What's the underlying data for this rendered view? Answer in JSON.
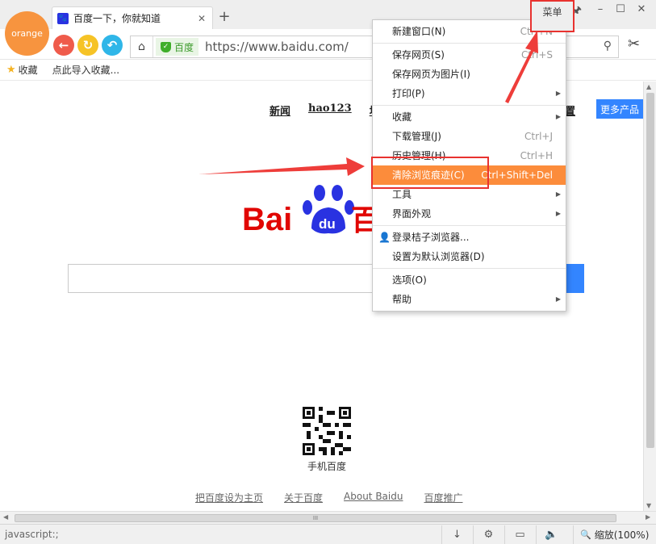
{
  "logo_label": "orange",
  "tab": {
    "title": "百度一下，你就知道",
    "close": "✕",
    "favicon": "paw-icon"
  },
  "new_tab": "+",
  "menu_button": "菜单",
  "window_controls": {
    "pin": "🖈",
    "minimize": "–",
    "maximize": "☐",
    "close": "✕"
  },
  "nav": {
    "back": "←",
    "refresh": "↻",
    "undo": "↶",
    "home": "⌂",
    "cut": "✂"
  },
  "address": {
    "secure_label": "百度",
    "url": "https://www.baidu.com/",
    "search_icon": "⚲"
  },
  "bookmarks": {
    "items": [
      "收藏",
      "点此导入收藏..."
    ]
  },
  "page": {
    "top_links": [
      "新闻",
      "hao123",
      "地"
    ],
    "settings_link": "置",
    "more_products": "更多产品",
    "search_button": "",
    "qr_label": "手机百度",
    "footer_links": [
      "把百度设为主页",
      "关于百度",
      "About Baidu",
      "百度推广"
    ],
    "logo_text_left": "Bai",
    "logo_paw_text": "du",
    "logo_text_right": "百"
  },
  "menu": {
    "items": [
      {
        "label": "新建窗口(N)",
        "shortcut": "Ctrl+N"
      },
      {
        "label": "保存网页(S)",
        "shortcut": "Ctrl+S"
      },
      {
        "label": "保存网页为图片(I)",
        "shortcut": ""
      },
      {
        "label": "打印(P)",
        "shortcut": ""
      },
      {
        "label": "收藏",
        "shortcut": ""
      },
      {
        "label": "下载管理(J)",
        "shortcut": "Ctrl+J"
      },
      {
        "label": "历史管理(H)",
        "shortcut": "Ctrl+H"
      },
      {
        "label": "清除浏览痕迹(C)",
        "shortcut": "Ctrl+Shift+Del"
      },
      {
        "label": "工具",
        "shortcut": ""
      },
      {
        "label": "界面外观",
        "shortcut": ""
      },
      {
        "label": "登录桔子浏览器...",
        "shortcut": ""
      },
      {
        "label": "设置为默认浏览器(D)",
        "shortcut": ""
      },
      {
        "label": "选项(O)",
        "shortcut": ""
      },
      {
        "label": "帮助",
        "shortcut": ""
      }
    ],
    "submenu_arrow": "▶",
    "user_icon": "👤"
  },
  "status": {
    "text": "javascript:;",
    "zoom": "缩放(100%)",
    "zoom_icon": "🔍",
    "download_icon": "↓",
    "settings_icon": "⚙",
    "screen_icon": "▭",
    "volume_icon": "🔈"
  },
  "scroll": {
    "grip": "III",
    "up": "▲",
    "down": "▼",
    "left": "◀",
    "right": "▶"
  },
  "colors": {
    "accent_orange": "#fc8c3b",
    "highlight_red": "#e8322f",
    "baidu_blue": "#2932e1",
    "baidu_red": "#e10602",
    "button_blue": "#3385ff"
  }
}
